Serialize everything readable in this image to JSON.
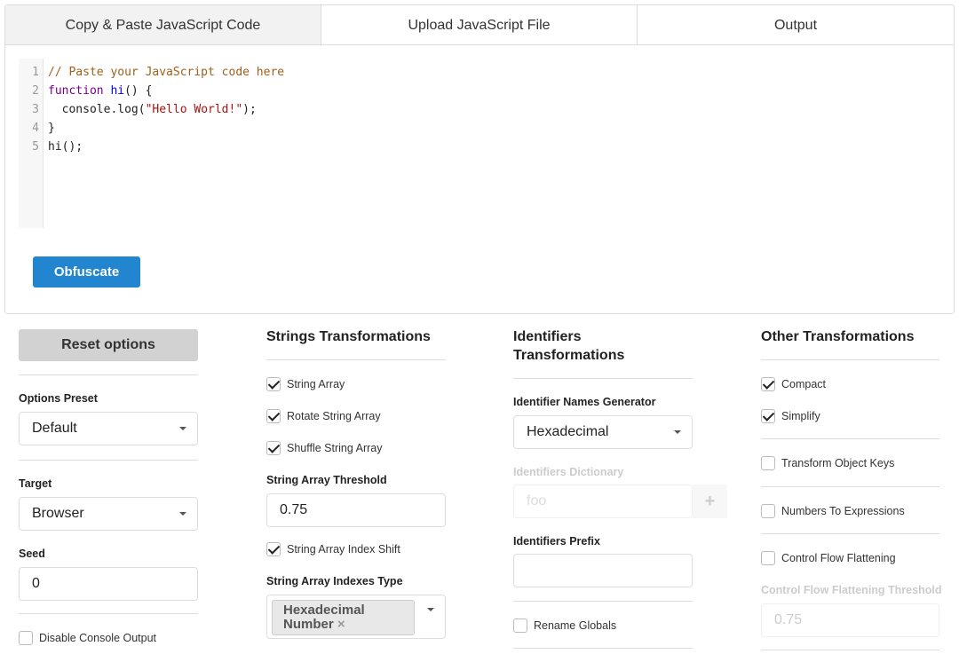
{
  "tabs": [
    "Copy & Paste JavaScript Code",
    "Upload JavaScript File",
    "Output"
  ],
  "editor": {
    "line_numbers": [
      "1",
      "2",
      "3",
      "4",
      "5"
    ],
    "lines": {
      "l1": "// Paste your JavaScript code here",
      "l2_kw": "function",
      "l2_fn": "hi",
      "l2_rest": "() {",
      "l3_a": "  console.log(",
      "l3_str": "\"Hello World!\"",
      "l3_b": ");",
      "l4": "}",
      "l5": "hi();"
    }
  },
  "obfuscate_label": "Obfuscate",
  "col1": {
    "reset_label": "Reset options",
    "preset_label": "Options Preset",
    "preset_value": "Default",
    "target_label": "Target",
    "target_value": "Browser",
    "seed_label": "Seed",
    "seed_value": "0",
    "disable_console": "Disable Console Output"
  },
  "col2": {
    "title": "Strings Transformations",
    "string_array": "String Array",
    "rotate": "Rotate String Array",
    "shuffle": "Shuffle String Array",
    "threshold_label": "String Array Threshold",
    "threshold_value": "0.75",
    "index_shift": "String Array Index Shift",
    "indexes_type_label": "String Array Indexes Type",
    "indexes_type_chip": "Hexadecimal Number",
    "chip_remove": "×"
  },
  "col3": {
    "title": "Identifiers Transformations",
    "generator_label": "Identifier Names Generator",
    "generator_value": "Hexadecimal",
    "dictionary_label": "Identifiers Dictionary",
    "dictionary_placeholder": "foo",
    "add": "+",
    "prefix_label": "Identifiers Prefix",
    "prefix_value": "",
    "rename_globals": "Rename Globals"
  },
  "col4": {
    "title": "Other Transformations",
    "compact": "Compact",
    "simplify": "Simplify",
    "transform_keys": "Transform Object Keys",
    "numbers_expr": "Numbers To Expressions",
    "cff": "Control Flow Flattening",
    "cff_threshold_label": "Control Flow Flattening Threshold",
    "cff_threshold_value": "0.75"
  },
  "colors": {
    "primary": "#2185d0",
    "tab_active": "#f2f2f2"
  }
}
